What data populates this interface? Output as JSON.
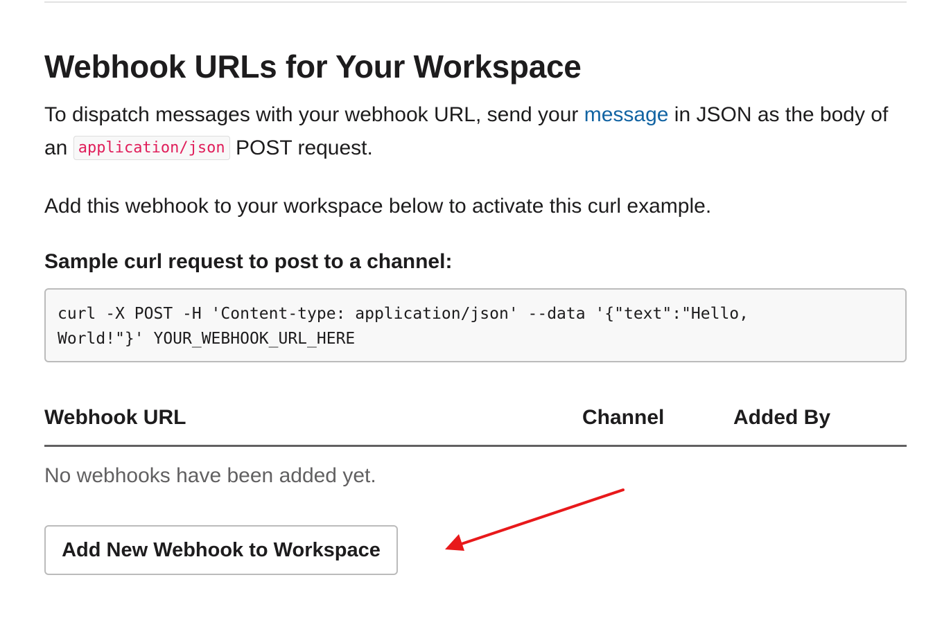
{
  "page": {
    "title": "Webhook URLs for Your Workspace"
  },
  "intro": {
    "text_before_link": "To dispatch messages with your webhook URL, send your ",
    "link_label": "message",
    "text_after_link": " in JSON as the body of an ",
    "inline_code": "application/json",
    "text_end": " POST request."
  },
  "activate_text": "Add this webhook to your workspace below to activate this curl example.",
  "sample": {
    "heading": "Sample curl request to post to a channel:",
    "code_lines": [
      "curl -X POST -H 'Content-type: application/json' --data '{\"text\":\"Hello,",
      "World!\"}' YOUR_WEBHOOK_URL_HERE"
    ]
  },
  "table": {
    "columns": [
      "Webhook URL",
      "Channel",
      "Added By"
    ],
    "empty_message": "No webhooks have been added yet."
  },
  "actions": {
    "add_button_label": "Add New Webhook to Workspace"
  },
  "annotation": {
    "arrow_color": "#e8191b"
  },
  "colors": {
    "link": "#1264a3",
    "inline_code": "#e01e5a",
    "text": "#1d1c1d",
    "muted_text": "#616061"
  }
}
